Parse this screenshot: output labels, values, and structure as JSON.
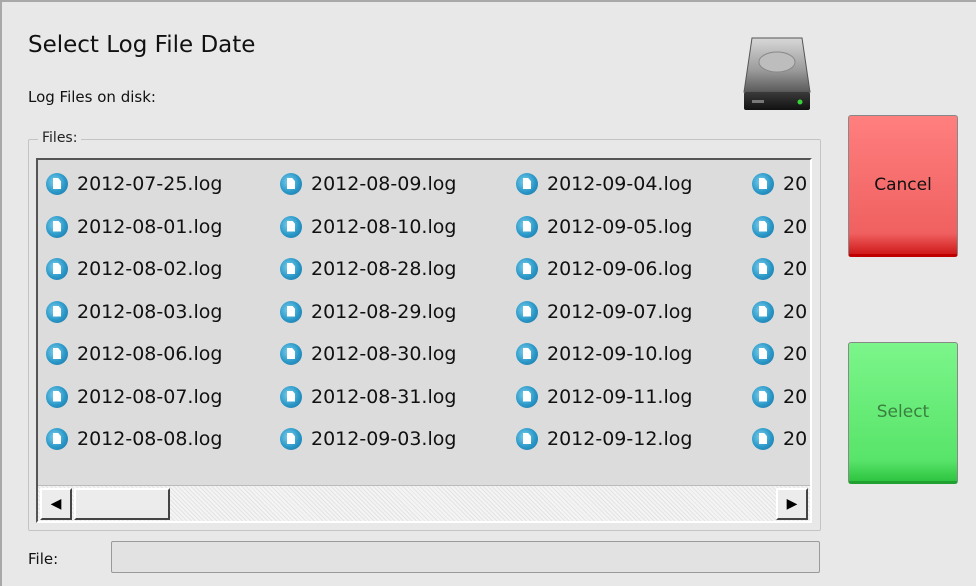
{
  "dialog": {
    "title": "Select Log File Date",
    "subtitle": "Log Files on disk:",
    "files_legend": "Files:",
    "file_label": "File:",
    "file_value": ""
  },
  "files": {
    "columns": [
      [
        "2012-07-25.log",
        "2012-08-01.log",
        "2012-08-02.log",
        "2012-08-03.log",
        "2012-08-06.log",
        "2012-08-07.log",
        "2012-08-08.log"
      ],
      [
        "2012-08-09.log",
        "2012-08-10.log",
        "2012-08-28.log",
        "2012-08-29.log",
        "2012-08-30.log",
        "2012-08-31.log",
        "2012-09-03.log"
      ],
      [
        "2012-09-04.log",
        "2012-09-05.log",
        "2012-09-06.log",
        "2012-09-07.log",
        "2012-09-10.log",
        "2012-09-11.log",
        "2012-09-12.log"
      ],
      [
        "20",
        "20",
        "20",
        "20",
        "20",
        "20",
        "20"
      ]
    ],
    "icon": "file-icon"
  },
  "buttons": {
    "cancel_label": "Cancel",
    "select_label": "Select",
    "cancel_color": "#f06060",
    "select_color": "#58e46a"
  },
  "scrollbar": {
    "left_arrow": "◀",
    "right_arrow": "▶"
  }
}
